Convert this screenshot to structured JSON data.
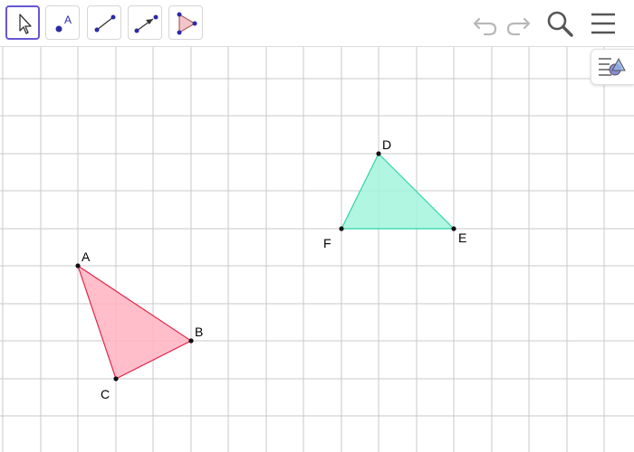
{
  "toolbar": {
    "tools": [
      {
        "name": "move-tool",
        "icon": "pointer-arrow-icon",
        "active": true
      },
      {
        "name": "point-tool",
        "icon": "point-icon",
        "label": "A"
      },
      {
        "name": "segment-tool",
        "icon": "segment-icon"
      },
      {
        "name": "vector-tool",
        "icon": "vector-icon"
      },
      {
        "name": "polygon-tool",
        "icon": "polygon-icon"
      }
    ],
    "right": [
      "undo-icon",
      "redo-icon",
      "search-icon",
      "menu-icon"
    ]
  },
  "style_bar": {
    "icon": "style-bar-toggle-icon"
  },
  "colors": {
    "grid": "#c8c8c8",
    "accent": "#6557d2",
    "triangle_abc_fill": "#ffb3c1",
    "triangle_abc_stroke": "#e0284a",
    "triangle_def_fill": "#a3f5dc",
    "triangle_def_stroke": "#2fd4a7"
  },
  "points": {
    "A": "A",
    "B": "B",
    "C": "C",
    "D": "D",
    "E": "E",
    "F": "F"
  }
}
